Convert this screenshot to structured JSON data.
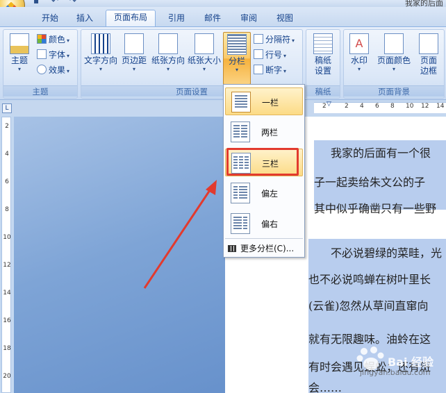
{
  "window": {
    "title": "我家的后面"
  },
  "tabs": [
    {
      "label": "开始"
    },
    {
      "label": "插入"
    },
    {
      "label": "页面布局",
      "active": true
    },
    {
      "label": "引用"
    },
    {
      "label": "邮件"
    },
    {
      "label": "审阅"
    },
    {
      "label": "视图"
    }
  ],
  "ribbon": {
    "theme_group": {
      "label": "主题",
      "theme_button": "主题",
      "colors": "颜色",
      "fonts": "字体",
      "effects": "效果"
    },
    "page_setup_group": {
      "label": "页面设置",
      "orientation": "文字方向",
      "margins": "页边距",
      "paper_orientation": "纸张方向",
      "paper_size": "纸张大小",
      "columns": "分栏",
      "breaks": "分隔符",
      "line_numbers": "行号",
      "hyphenation": "断字"
    },
    "draft_group": {
      "label": "稿纸",
      "draft_settings_line1": "稿纸",
      "draft_settings_line2": "设置"
    },
    "page_background_group": {
      "label": "页面背景",
      "watermark": "水印",
      "page_color": "页面颜色",
      "page_borders_line1": "页面",
      "page_borders_line2": "边框"
    }
  },
  "ruler": {
    "corner_glyph": "L",
    "h_ticks": [
      "2",
      "2",
      "4",
      "6",
      "8",
      "10",
      "12",
      "14"
    ],
    "v_ticks": [
      "2",
      "4",
      "6",
      "8",
      "10",
      "12",
      "14",
      "16",
      "18",
      "20"
    ]
  },
  "columns_menu": {
    "items": [
      {
        "label": "一栏"
      },
      {
        "label": "两栏"
      },
      {
        "label": "三栏"
      },
      {
        "label": "偏左"
      },
      {
        "label": "偏右"
      }
    ],
    "more": "更多分栏(C)..."
  },
  "document": {
    "lines": [
      "我家的后面有一个很",
      "子一起卖给朱文公的子",
      "其中似乎确凿只有一些野",
      "不必说碧绿的菜畦，光",
      "也不必说鸣蝉在树叶里长",
      "(云雀)忽然从草间直窜向",
      "就有无限趣味。油蛉在这",
      "有时会遇见蜈蚣；还有斑",
      "会……"
    ]
  },
  "watermark": {
    "text": "Bai 经验",
    "url": "jingyan.baidu.com"
  },
  "colors": {
    "accent_red": "#e23a2e",
    "ribbon_text": "#15428b",
    "highlight": "#fcdb86"
  }
}
